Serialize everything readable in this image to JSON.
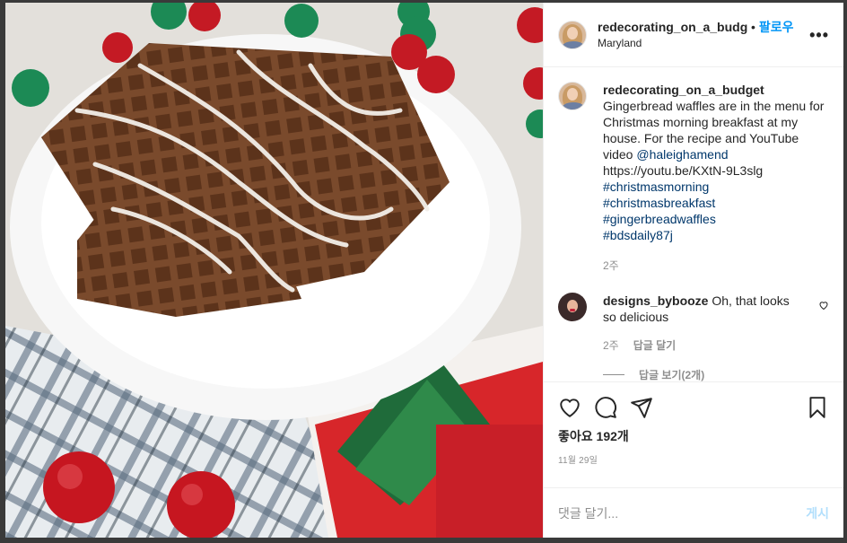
{
  "post": {
    "author": "redecorating_on_a_budget",
    "follow_label": "팔로우",
    "dot": "•",
    "location": "Maryland",
    "more": "•••",
    "caption": {
      "author": "redecorating_on_a_budget",
      "text": "Gingerbread waffles are in the menu for Christmas morning breakfast at my house. For the recipe and YouTube video",
      "mention": "@haleighamend",
      "url": "https://youtu.be/KXtN-9L3slg",
      "hashtags": [
        "#christmasmorning",
        "#christmasbreakfast",
        "#gingerbreadwaffles",
        "#bdsdaily87j"
      ],
      "time": "2주"
    },
    "comment": {
      "author": "designs_bybooze",
      "text": "Oh, that looks so delicious",
      "time": "2주",
      "reply_label": "답글 달기",
      "view_replies": "답글 보기(2개)"
    },
    "likes": "좋아요 192개",
    "date": "11월 29일",
    "add_comment_placeholder": "댓글 달기...",
    "post_button": "게시"
  },
  "colors": {
    "accent": "#0095f6",
    "link": "#00376b",
    "muted": "#8e8e8e"
  },
  "icons": [
    "more-icon",
    "heart-icon",
    "comment-icon",
    "share-icon",
    "bookmark-icon",
    "small-heart-icon"
  ]
}
